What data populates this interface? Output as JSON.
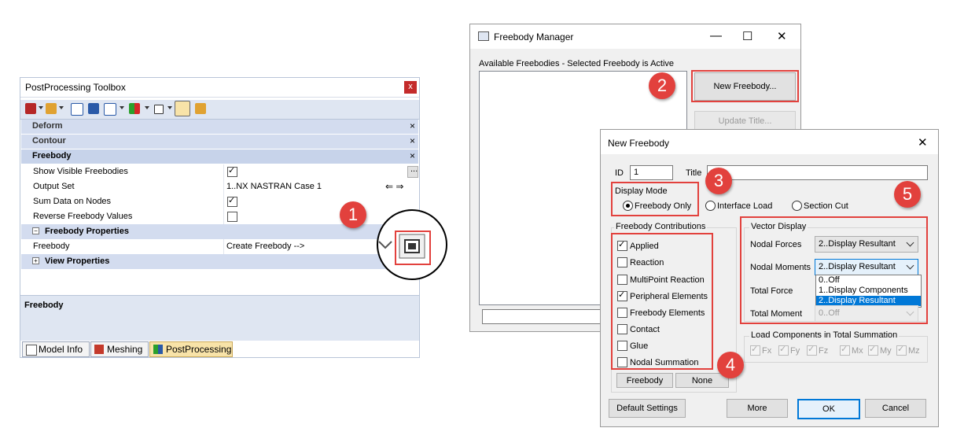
{
  "toolbox": {
    "title": "PostProcessing Toolbox",
    "close": "x",
    "sections": {
      "deform": "Deform",
      "contour": "Contour",
      "freebody": "Freebody"
    },
    "close_x": "×",
    "rows": [
      {
        "label": "Show Visible Freebodies",
        "value": ""
      },
      {
        "label": "Output Set",
        "value": "1..NX NASTRAN Case 1"
      },
      {
        "label": "Sum Data on Nodes",
        "value": ""
      },
      {
        "label": "Reverse Freebody Values",
        "value": ""
      }
    ],
    "ellipsis": "...",
    "freebody_properties": "Freebody Properties",
    "freebody_label": "Freebody",
    "freebody_value": "Create Freebody -->",
    "view_properties": "View Properties",
    "bottom_label": "Freebody",
    "tabs": [
      "Model Info",
      "Meshing",
      "PostProcessing"
    ],
    "nav_arrows": "⇐ ⇒"
  },
  "manager": {
    "title": "Freebody Manager",
    "caption": "Available Freebodies - Selected Freebody is Active",
    "new_button": "New Freebody...",
    "update_button": "Update Title..."
  },
  "new_freebody": {
    "title": "New Freebody",
    "id_label": "ID",
    "id_value": "1",
    "title_label": "Title",
    "title_value": "",
    "display_mode_label": "Display Mode",
    "modes": [
      "Freebody Only",
      "Interface Load",
      "Section Cut"
    ],
    "contributions_label": "Freebody Contributions",
    "contributions": [
      {
        "label": "Applied",
        "checked": true
      },
      {
        "label": "Reaction",
        "checked": false
      },
      {
        "label": "MultiPoint Reaction",
        "checked": false
      },
      {
        "label": "Peripheral Elements",
        "checked": true
      },
      {
        "label": "Freebody Elements",
        "checked": false
      },
      {
        "label": "Contact",
        "checked": false
      },
      {
        "label": "Glue",
        "checked": false
      },
      {
        "label": "Nodal Summation",
        "checked": false
      }
    ],
    "freebody_button": "Freebody",
    "none_button": "None",
    "vector_display_label": "Vector Display",
    "nodal_forces_label": "Nodal Forces",
    "nodal_forces_value": "2..Display Resultant",
    "nodal_moments_label": "Nodal Moments",
    "nodal_moments_value": "2..Display Resultant",
    "total_force_label": "Total Force",
    "total_moment_label": "Total Moment",
    "total_moment_value": "0..Off",
    "dropdown_options": [
      "0..Off",
      "1..Display Components",
      "2..Display Resultant"
    ],
    "load_components_label": "Load Components in Total Summation",
    "load_components": [
      "Fx",
      "Fy",
      "Fz",
      "Mx",
      "My",
      "Mz"
    ],
    "default_settings_button": "Default Settings",
    "more_button": "More",
    "ok_button": "OK",
    "cancel_button": "Cancel"
  },
  "callouts": [
    "1",
    "2",
    "3",
    "4",
    "5"
  ],
  "colors": {
    "accent_red": "#e2413d",
    "toolbox_header": "#d3dcef",
    "selection_blue": "#0078d7"
  }
}
